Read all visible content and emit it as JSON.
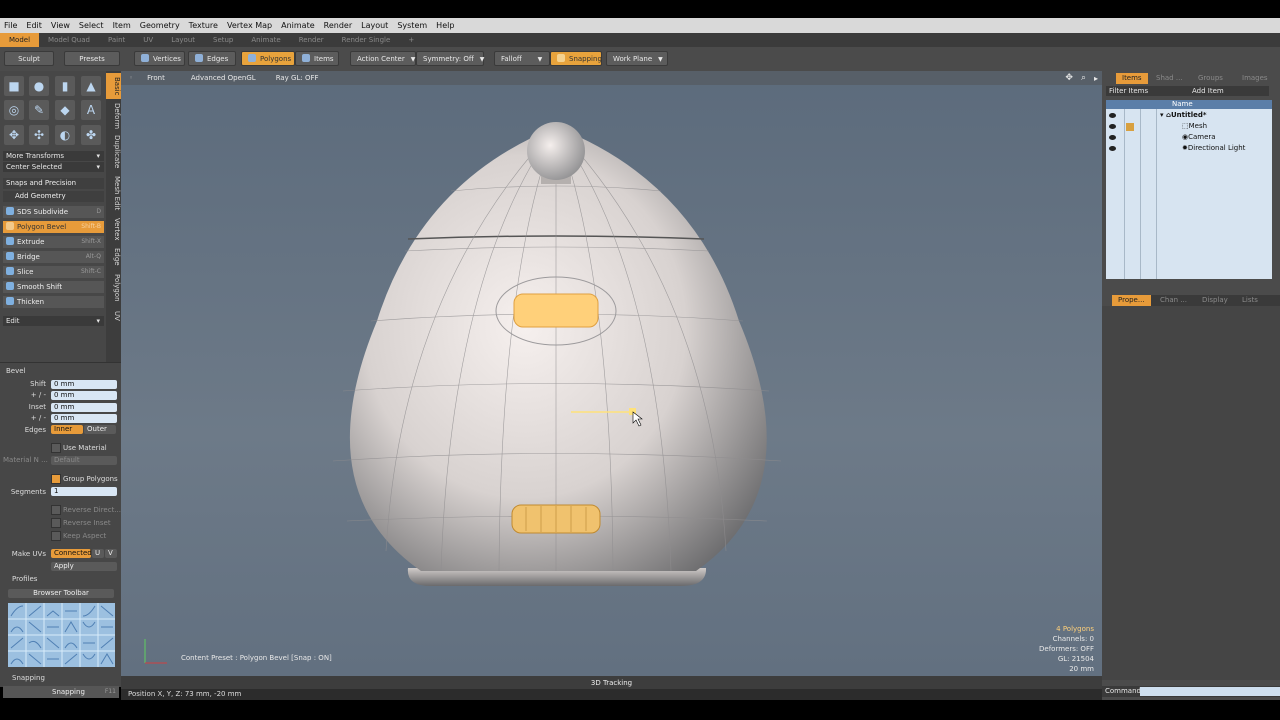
{
  "menu": [
    "File",
    "Edit",
    "View",
    "Select",
    "Item",
    "Geometry",
    "Texture",
    "Vertex Map",
    "Animate",
    "Render",
    "Layout",
    "System",
    "Help"
  ],
  "layout_tabs": [
    "Model",
    "Model Quad",
    "Paint",
    "UV",
    "Layout",
    "Setup",
    "Animate",
    "Render",
    "Render Single",
    "+"
  ],
  "toolbar": {
    "sculpt": "Sculpt",
    "presets": "Presets",
    "vertices": "Vertices",
    "edges": "Edges",
    "polygons": "Polygons",
    "items": "Items",
    "action_center": "Action Center",
    "symmetry": "Symmetry: Off",
    "falloff": "Falloff",
    "snapping": "Snapping",
    "work_plane": "Work Plane"
  },
  "vertical_tabs": [
    "Basic",
    "Deform",
    "Duplicate",
    "Mesh Edit",
    "Vertex",
    "Edge",
    "Polygon",
    "UV"
  ],
  "left": {
    "more_transforms": "More Transforms",
    "center_selected": "Center Selected",
    "snaps_precision": "Snaps and Precision",
    "add_geometry": "Add Geometry",
    "tools": [
      {
        "label": "SDS Subdivide",
        "shortcut": "D"
      },
      {
        "label": "Polygon Bevel",
        "shortcut": "Shift-B"
      },
      {
        "label": "Extrude",
        "shortcut": "Shift-X"
      },
      {
        "label": "Bridge",
        "shortcut": "Alt-Q"
      },
      {
        "label": "Slice",
        "shortcut": "Shift-C"
      },
      {
        "label": "Smooth Shift",
        "shortcut": ""
      },
      {
        "label": "Thicken",
        "shortcut": ""
      }
    ],
    "edit": "Edit"
  },
  "bevel": {
    "title": "Bevel",
    "shift_label": "Shift",
    "shift": "0 mm",
    "pm1_label": "+ / -",
    "pm1": "0 mm",
    "inset_label": "Inset",
    "inset": "0 mm",
    "pm2_label": "+ / -",
    "pm2": "0 mm",
    "edges_label": "Edges",
    "edges_inner": "Inner",
    "edges_outer": "Outer",
    "use_material": "Use Material",
    "material_label": "Material N ...",
    "material_value": "Default",
    "group_polygons": "Group Polygons",
    "segments_label": "Segments",
    "segments": "1",
    "reverse_direction": "Reverse Direct...",
    "reverse_inset": "Reverse Inset",
    "keep_aspect": "Keep Aspect",
    "make_uvs_label": "Make UVs",
    "make_uvs_value": "Connected",
    "u": "U",
    "v": "V",
    "apply": "Apply",
    "profiles": "Profiles",
    "browser_toolbar": "Browser Toolbar",
    "snapping_head": "Snapping",
    "snapping_row": "Snapping",
    "snapping_key": "F11"
  },
  "viewport": {
    "view": "Front",
    "render_mode": "Advanced OpenGL",
    "ray_gl": "Ray GL: OFF",
    "content_preset": "Content Preset : Polygon Bevel  [Snap : ON]",
    "stats": {
      "polygons": "4 Polygons",
      "channels": "Channels: 0",
      "deformers": "Deformers: OFF",
      "gl": "GL: 21504",
      "unit": "20 mm"
    }
  },
  "statusbar": {
    "center": "3D Tracking",
    "position": "Position X, Y, Z:  73 mm, -20 mm"
  },
  "right": {
    "tabs": [
      "Items",
      "Shad ...",
      "Groups",
      "Images"
    ],
    "filter": "Filter Items",
    "add_item": "Add Item",
    "name_col": "Name",
    "tree": [
      "Untitled*",
      "Mesh",
      "Camera",
      "Directional Light"
    ],
    "prop_tabs": [
      "Prope...",
      "Chan ...",
      "Display",
      "Lists"
    ],
    "command": "Command"
  },
  "colors": {
    "accent": "#e79b3a",
    "selection": "#ffd07a",
    "viewport_bg": "#647282"
  }
}
